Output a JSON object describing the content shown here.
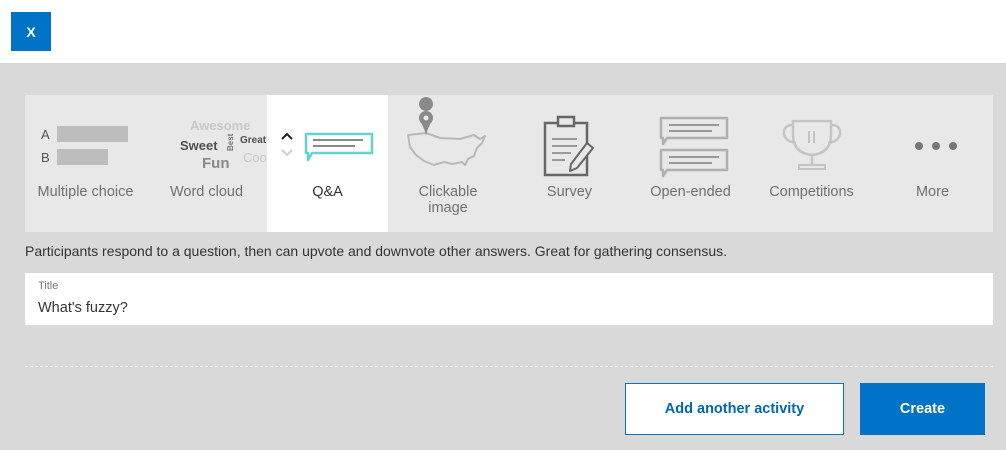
{
  "close_button": {
    "label": "X"
  },
  "activities": {
    "multiple_choice": {
      "label": "Multiple choice",
      "letters": [
        "A",
        "B"
      ]
    },
    "word_cloud": {
      "label": "Word cloud",
      "words": [
        "Awesome",
        "Sweet",
        "Best",
        "Great",
        "Fun",
        "Cool"
      ]
    },
    "qa": {
      "label": "Q&A"
    },
    "clickable_image": {
      "label": "Clickable image"
    },
    "survey": {
      "label": "Survey"
    },
    "open_ended": {
      "label": "Open-ended"
    },
    "competitions": {
      "label": "Competitions"
    },
    "more": {
      "label": "More"
    }
  },
  "selected_activity": "qa",
  "description": "Participants respond to a question, then can upvote and downvote other answers. Great for gathering consensus.",
  "title_field": {
    "label": "Title",
    "value": "What's fuzzy?"
  },
  "actions": {
    "add_label": "Add another activity",
    "create_label": "Create"
  },
  "colors": {
    "accent": "#0073c7",
    "qa_highlight": "#5fd4d0",
    "icon_gray": "#bdbdbd"
  }
}
